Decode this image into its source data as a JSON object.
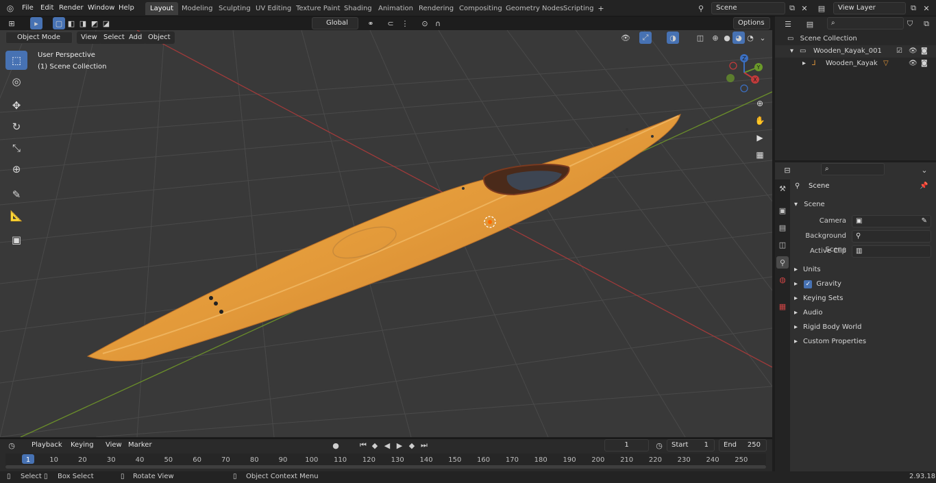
{
  "menubar": {
    "items": [
      "File",
      "Edit",
      "Render",
      "Window",
      "Help"
    ]
  },
  "workspaces": [
    "Layout",
    "Modeling",
    "Sculpting",
    "UV Editing",
    "Texture Paint",
    "Shading",
    "Animation",
    "Rendering",
    "Compositing",
    "Geometry Nodes",
    "Scripting"
  ],
  "active_workspace": "Layout",
  "scene_field": "Scene",
  "view_layer_field": "View Layer",
  "viewport_header": {
    "mode": "Object Mode",
    "menus": [
      "View",
      "Select",
      "Add",
      "Object"
    ],
    "transform_orientation": "Global",
    "options": "Options"
  },
  "viewport": {
    "perspective_label": "User Perspective",
    "collection_label": "(1) Scene Collection",
    "gizmo_axes": {
      "x": "X",
      "y": "Y",
      "z": "Z"
    },
    "colors": {
      "background": "#393939",
      "grid": "#4a4a4a",
      "x_axis": "#a03a3a",
      "y_axis": "#6b8f2a",
      "kayak": "#e39a3a"
    }
  },
  "outliner": {
    "root": "Scene Collection",
    "items": [
      {
        "label": "Wooden_Kayak_001",
        "type": "collection"
      },
      {
        "label": "Wooden_Kayak",
        "type": "object"
      }
    ]
  },
  "properties": {
    "header": "Scene",
    "section": "Scene",
    "fields": [
      {
        "label": "Camera",
        "value": ""
      },
      {
        "label": "Background Scene",
        "value": ""
      },
      {
        "label": "Active Clip",
        "value": ""
      }
    ],
    "panels": [
      "Units",
      "Gravity",
      "Keying Sets",
      "Audio",
      "Rigid Body World",
      "Custom Properties"
    ],
    "gravity_checked": true
  },
  "timeline": {
    "menus": [
      "Playback",
      "Keying",
      "View",
      "Marker"
    ],
    "current_frame": "1",
    "start_label": "Start",
    "start": "1",
    "end_label": "End",
    "end": "250",
    "ticks": [
      "1",
      "10",
      "20",
      "30",
      "40",
      "50",
      "60",
      "70",
      "80",
      "90",
      "100",
      "110",
      "120",
      "130",
      "140",
      "150",
      "160",
      "170",
      "180",
      "190",
      "200",
      "210",
      "220",
      "230",
      "240",
      "250"
    ]
  },
  "statusbar": {
    "select": "Select",
    "box_select": "Box Select",
    "rotate_view": "Rotate View",
    "context_menu": "Object Context Menu",
    "version": "2.93.18"
  }
}
